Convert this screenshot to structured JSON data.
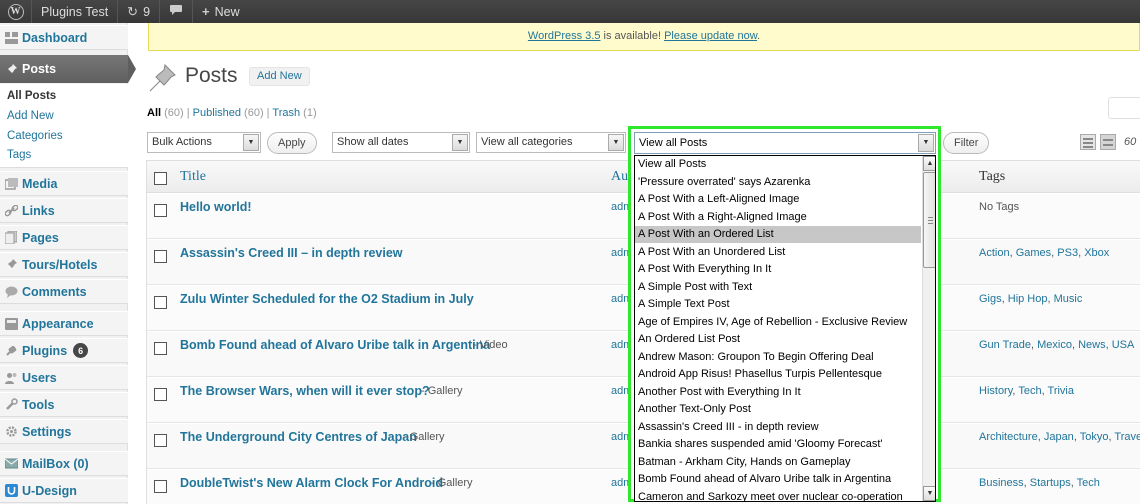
{
  "admin_bar": {
    "site_name": "Plugins Test",
    "updates_count": "9",
    "new_label": "New"
  },
  "sidebar": {
    "items": [
      {
        "label": "Dashboard",
        "icon": "dashboard-icon"
      },
      {
        "label": "Posts",
        "icon": "pushpin-icon"
      },
      {
        "label": "Media",
        "icon": "media-icon"
      },
      {
        "label": "Links",
        "icon": "links-icon"
      },
      {
        "label": "Pages",
        "icon": "pages-icon"
      },
      {
        "label": "Tours/Hotels",
        "icon": "pushpin-icon"
      },
      {
        "label": "Comments",
        "icon": "comments-icon"
      },
      {
        "label": "Appearance",
        "icon": "appearance-icon"
      },
      {
        "label": "Plugins",
        "icon": "plugins-icon",
        "badge": "6"
      },
      {
        "label": "Users",
        "icon": "users-icon"
      },
      {
        "label": "Tools",
        "icon": "tools-icon"
      },
      {
        "label": "Settings",
        "icon": "settings-icon"
      },
      {
        "label": "MailBox (0)",
        "icon": "mailbox-icon"
      },
      {
        "label": "U-Design",
        "icon": "udesign-icon"
      }
    ],
    "posts_submenu": [
      "All Posts",
      "Add New",
      "Categories",
      "Tags"
    ]
  },
  "update_nag": {
    "version_link": "WordPress 3.5",
    "middle": " is available! ",
    "update_link": "Please update now",
    "end": "."
  },
  "page": {
    "title": "Posts",
    "add_new": "Add New"
  },
  "status_filters": {
    "all": "All",
    "all_count": " (60)",
    "sep1": " | ",
    "published": "Published",
    "published_count": " (60)",
    "sep2": " | ",
    "trash": "Trash",
    "trash_count": " (1)"
  },
  "tablenav": {
    "bulk_actions": "Bulk Actions",
    "apply": "Apply",
    "dates": "Show all dates",
    "categories": "View all categories",
    "posts_select": "View all Posts",
    "filter": "Filter",
    "count": "60"
  },
  "table": {
    "columns": {
      "title": "Title",
      "author": "Au",
      "tags": "Tags"
    },
    "rows": [
      {
        "title": "Hello world!",
        "format": "",
        "author": "adm",
        "tags": [],
        "tags_text": "No Tags"
      },
      {
        "title": "Assassin's Creed III – in depth review",
        "format": "",
        "author": "adm",
        "tags": [
          "Action",
          "Games",
          "PS3",
          "Xbox"
        ]
      },
      {
        "title": "Zulu Winter Scheduled for the O2 Stadium in July",
        "format": "",
        "author": "adm",
        "tags": [
          "Gigs",
          "Hip Hop",
          "Music"
        ]
      },
      {
        "title": "Bomb Found ahead of Alvaro Uribe talk in Argentina",
        "format": " - Video",
        "author": "adm",
        "tags": [
          "Gun Trade",
          "Mexico",
          "News",
          "USA"
        ]
      },
      {
        "title": "The Browser Wars, when will it ever stop?",
        "format": " - Gallery",
        "author": "adm",
        "tags": [
          "History",
          "Tech",
          "Trivia"
        ]
      },
      {
        "title": "The Underground City Centres of Japan",
        "format": " - Gallery",
        "author": "adm",
        "tags": [
          "Architecture",
          "Japan",
          "Tokyo",
          "Trave"
        ]
      },
      {
        "title": "DoubleTwist's New Alarm Clock For Android",
        "format": " - Gallery",
        "author": "adm",
        "tags": [
          "Business",
          "Startups",
          "Tech"
        ]
      }
    ]
  },
  "dropdown": {
    "selected_index": 4,
    "options": [
      "View all Posts",
      "'Pressure overrated' says Azarenka",
      "A Post With a Left-Aligned Image",
      "A Post With a Right-Aligned Image",
      "A Post With an Ordered List",
      "A Post With an Unordered List",
      "A Post With Everything In It",
      "A Simple Post with Text",
      "A Simple Text Post",
      "Age of Empires IV, Age of Rebellion - Exclusive Review",
      "An Ordered List Post",
      "Andrew Mason: Groupon To Begin Offering Deal",
      "Android App Risus! Phasellus Turpis Pellentesque",
      "Another Post with Everything In It",
      "Another Text-Only Post",
      "Assassin's Creed III - in depth review",
      "Bankia shares suspended amid 'Gloomy Forecast'",
      "Batman - Arkham City, Hands on Gameplay",
      "Bomb Found ahead of Alvaro Uribe talk in Argentina",
      "Cameron and Sarkozy meet over nuclear co-operation"
    ]
  },
  "colors": {
    "link": "#21759b",
    "highlight_border": "#2ee82e",
    "admin_bar": "#464646",
    "nag_bg": "#fffbcc"
  }
}
